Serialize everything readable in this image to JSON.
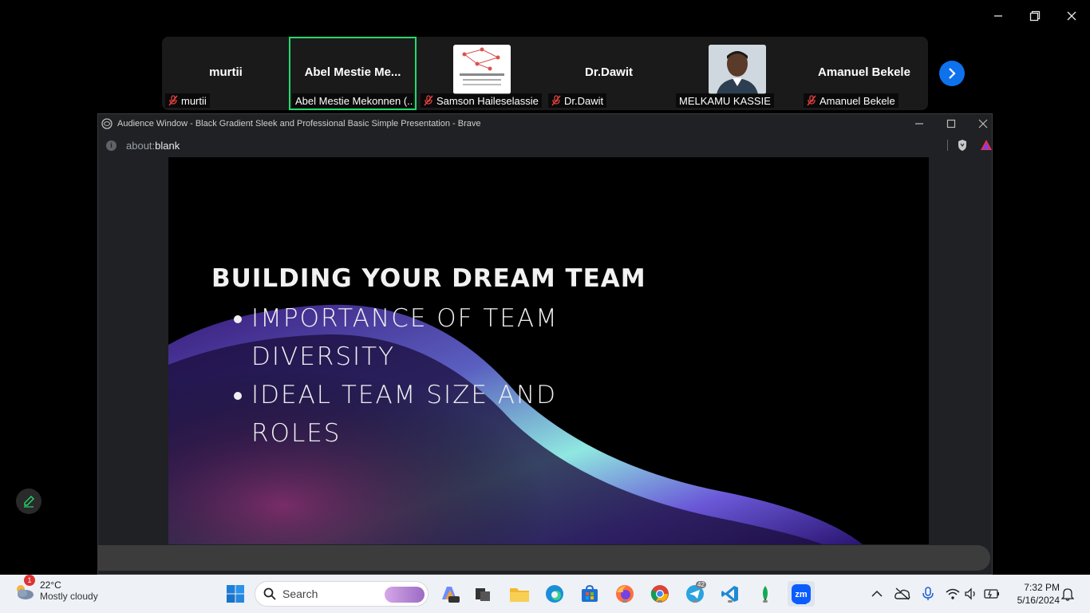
{
  "participants": [
    {
      "tile_name": "murtii",
      "label": "murtii",
      "muted": true
    },
    {
      "tile_name": "Abel  Mestie  Me...",
      "label": "Abel Mestie Mekonnen (...",
      "muted": false
    },
    {
      "tile_name": "",
      "label": "Samson Haileselassie",
      "muted": true
    },
    {
      "tile_name": "Dr.Dawit",
      "label": "Dr.Dawit",
      "muted": true
    },
    {
      "tile_name": "",
      "label": "MELKAMU KASSIE",
      "muted": false
    },
    {
      "tile_name": "Amanuel Bekele",
      "label": "Amanuel Bekele",
      "muted": true
    }
  ],
  "browser": {
    "title": "Audience Window - Black Gradient Sleek and Professional Basic Simple Presentation - Brave",
    "address_prefix": "about:",
    "address_main": "blank"
  },
  "slide": {
    "title": "BUILDING YOUR DREAM TEAM",
    "bullets": [
      "IMPORTANCE OF TEAM DIVERSITY",
      "IDEAL TEAM SIZE AND ROLES"
    ]
  },
  "taskbar": {
    "weather_temp": "22°C",
    "weather_condition": "Mostly cloudy",
    "weather_badge": "1",
    "search_placeholder": "Search",
    "telegram_badge": "42",
    "time": "7:32 PM",
    "date": "5/16/2024"
  },
  "colors": {
    "active_speaker": "#23d96c",
    "zoom_blue": "#0e72ed"
  }
}
